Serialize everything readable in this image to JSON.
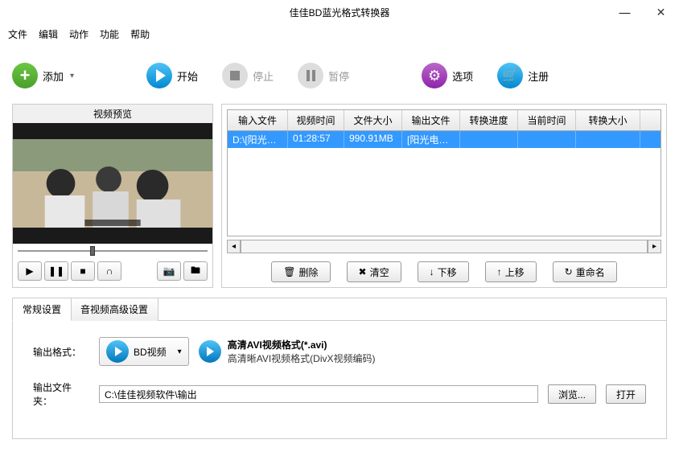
{
  "window": {
    "title": "佳佳BD蓝光格式转换器"
  },
  "menu": {
    "file": "文件",
    "edit": "编辑",
    "action": "动作",
    "function": "功能",
    "help": "帮助"
  },
  "toolbar": {
    "add": "添加",
    "start": "开始",
    "stop": "停止",
    "pause": "暂停",
    "options": "选项",
    "register": "注册"
  },
  "preview": {
    "title": "视频预览"
  },
  "grid": {
    "headers": {
      "input": "输入文件",
      "duration": "视频时间",
      "size": "文件大小",
      "output": "输出文件",
      "progress": "转换进度",
      "current": "当前时间",
      "outsize": "转换大小"
    },
    "row": {
      "input": "D:\\[阳光电...",
      "duration": "01:28:57",
      "size": "990.91MB",
      "output": "[阳光电影...",
      "progress": "",
      "current": "",
      "outsize": ""
    }
  },
  "actions": {
    "delete": "删除",
    "clear": "清空",
    "down": "下移",
    "up": "上移",
    "rename": "重命名"
  },
  "tabs": {
    "general": "常规设置",
    "advanced": "音视频高级设置"
  },
  "settings": {
    "format_label": "输出格式：",
    "format_combo": "BD视频",
    "format_title": "高清AVI视频格式(*.avi)",
    "format_sub": "高清晰AVI视频格式(DivX视频编码)",
    "folder_label": "输出文件夹：",
    "folder_path": "C:\\佳佳视频软件\\输出",
    "browse": "浏览...",
    "open": "打开"
  }
}
